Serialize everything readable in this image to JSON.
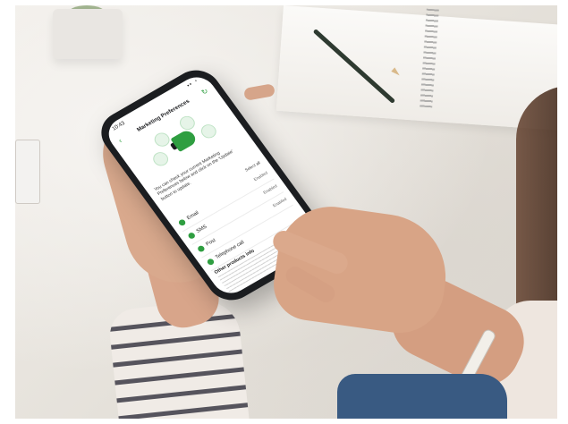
{
  "screen": {
    "status_time": "10:43",
    "status_icons": "▪▪ ◔",
    "title": "Marketing Preferences",
    "intro": "You can check your current Marketing Preferences below and click on the 'Update' button to update.",
    "select_all": "Select all",
    "preferences": [
      {
        "label": "Email",
        "state": "Enabled"
      },
      {
        "label": "SMS",
        "state": "Enabled"
      },
      {
        "label": "Post",
        "state": "Enabled"
      },
      {
        "label": "Telephone call",
        "state": ""
      }
    ],
    "section_title": "Other products info"
  },
  "colors": {
    "accent": "#2f9e41",
    "phone_body": "#1b1d20"
  }
}
